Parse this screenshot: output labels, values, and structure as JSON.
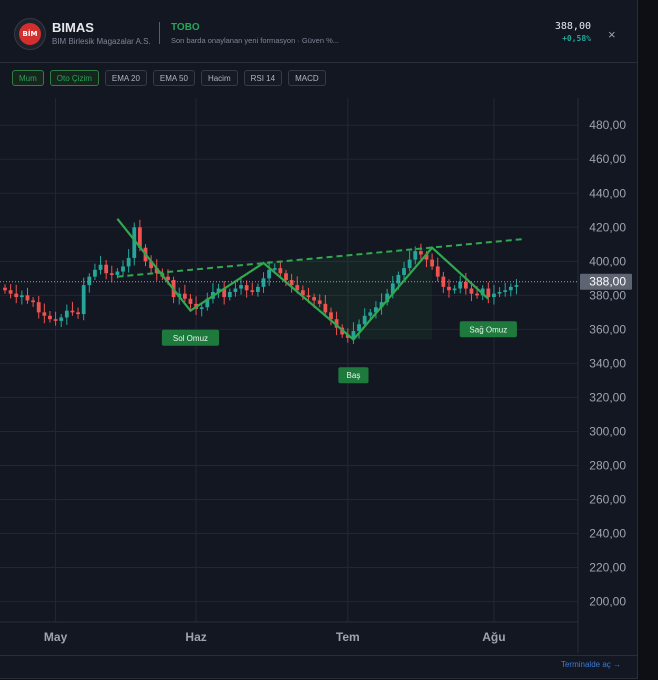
{
  "header": {
    "logo_text": "BİM",
    "symbol": "BIMAS",
    "company": "BIM Birlesik Magazalar A.S.",
    "pattern_name": "TOBO",
    "pattern_note": "Son barda onaylanan yeni formasyon · Güven %...",
    "price": "388,00",
    "change": "+0,58%",
    "close_icon": "×"
  },
  "toolbar": [
    {
      "label": "Mum",
      "active": true
    },
    {
      "label": "Oto Çizim",
      "active": true
    },
    {
      "label": "EMA 20",
      "active": false
    },
    {
      "label": "EMA 50",
      "active": false
    },
    {
      "label": "Hacim",
      "active": false
    },
    {
      "label": "RSI 14",
      "active": false
    },
    {
      "label": "MACD",
      "active": false
    }
  ],
  "chart_data": {
    "type": "candlestick",
    "y_ticks": [
      "480,00",
      "460,00",
      "440,00",
      "420,00",
      "400,00",
      "380,00",
      "360,00",
      "340,00",
      "320,00",
      "300,00",
      "280,00",
      "260,00",
      "240,00",
      "220,00",
      "200,00"
    ],
    "y_tick_values": [
      480,
      460,
      440,
      420,
      400,
      380,
      360,
      340,
      320,
      300,
      280,
      260,
      240,
      220,
      200
    ],
    "ylim": [
      188,
      496
    ],
    "x_labels": [
      {
        "label": "May",
        "index": 9
      },
      {
        "label": "Haz",
        "index": 34
      },
      {
        "label": "Tem",
        "index": 61
      },
      {
        "label": "Ağu",
        "index": 87
      }
    ],
    "last_price": 388,
    "last_price_label": "388,00",
    "closes": [
      383,
      381,
      379,
      380,
      377,
      376,
      370,
      368,
      366,
      365,
      367,
      371,
      370,
      369,
      386,
      391,
      395,
      398,
      393,
      392,
      394,
      397,
      402,
      420,
      408,
      400,
      396,
      393,
      391,
      389,
      379,
      381,
      378,
      375,
      372,
      373,
      378,
      382,
      384,
      379,
      382,
      384,
      386,
      383,
      382,
      385,
      390,
      395,
      396,
      393,
      389,
      386,
      383,
      380,
      379,
      377,
      375,
      370,
      366,
      361,
      357,
      355,
      359,
      363,
      368,
      370,
      373,
      376,
      381,
      387,
      392,
      396,
      401,
      406,
      404,
      401,
      397,
      391,
      385,
      383,
      384,
      388,
      384,
      381,
      380,
      384,
      379,
      381,
      382,
      383,
      385,
      386
    ],
    "patterns": {
      "neckline_label": "",
      "labels": [
        {
          "text": "Sol Omuz",
          "index": 33,
          "value": 368
        },
        {
          "text": "Baş",
          "index": 62,
          "value": 346
        },
        {
          "text": "Sağ Omuz",
          "index": 86,
          "value": 373
        }
      ],
      "zigzag": [
        [
          20,
          425
        ],
        [
          33,
          371
        ],
        [
          46,
          399
        ],
        [
          62,
          354
        ],
        [
          76,
          408
        ],
        [
          86,
          378
        ]
      ],
      "neckline": [
        [
          20,
          391
        ],
        [
          92,
          413
        ]
      ]
    },
    "colors": {
      "up": "#26a69a",
      "down": "#ef5350",
      "pattern": "#2fa84f",
      "grid": "#232733"
    }
  },
  "footer": {
    "terminal_link": "Terminalde aç →"
  }
}
